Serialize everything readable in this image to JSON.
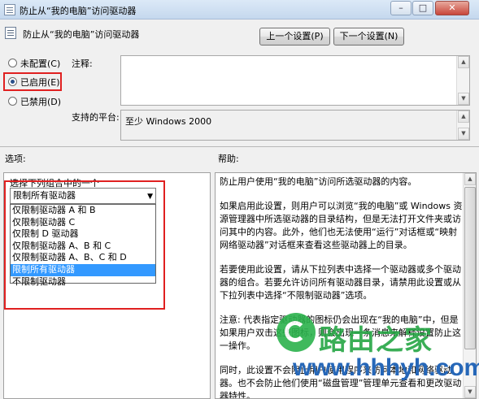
{
  "window": {
    "title": "防止从“我的电脑”访问驱动器",
    "minimize_glyph": "–",
    "maximize_glyph": "□",
    "close_glyph": "✕"
  },
  "header": {
    "policy_title": "防止从“我的电脑”访问驱动器",
    "prev_button": "上一个设置(P)",
    "next_button": "下一个设置(N)"
  },
  "state": {
    "options": [
      {
        "label": "未配置(C)",
        "checked": false
      },
      {
        "label": "已启用(E)",
        "checked": true
      },
      {
        "label": "已禁用(D)",
        "checked": false
      }
    ]
  },
  "comment": {
    "label": "注释:",
    "value": ""
  },
  "supported": {
    "label": "支持的平台:",
    "value": "至少 Windows 2000"
  },
  "options_section": {
    "label": "选项:",
    "instruction": "选择下列组合中的一个",
    "selected_value": "限制所有驱动器",
    "dropdown_items": [
      {
        "label": "仅限制驱动器 A 和 B",
        "selected": false
      },
      {
        "label": "仅限制驱动器 C",
        "selected": false
      },
      {
        "label": "仅限制 D 驱动器",
        "selected": false
      },
      {
        "label": "仅限制驱动器 A、B 和 C",
        "selected": false
      },
      {
        "label": "仅限制驱动器 A、B、C 和 D",
        "selected": false
      },
      {
        "label": "限制所有驱动器",
        "selected": true
      },
      {
        "label": "不限制驱动器",
        "selected": false
      }
    ]
  },
  "help_section": {
    "label": "帮助:",
    "paragraphs": [
      "防止用户使用“我的电脑”访问所选驱动器的内容。",
      "如果启用此设置，则用户可以浏览“我的电脑”或 Windows 资源管理器中所选驱动器的目录结构，但是无法打开文件夹或访问其中的内容。此外，他们也无法使用“运行”对话框或“映射网络驱动器”对话框来查看这些驱动器上的目录。",
      "若要使用此设置，请从下拉列表中选择一个驱动器或多个驱动器的组合。若要允许访问所有驱动器目录，请禁用此设置或从下拉列表中选择“不限制驱动器”选项。",
      "注意: 代表指定驱动器的图标仍会出现在“我的电脑”中，但是如果用户双击这些图标，则会出现一条消息来解释设置防止这一操作。",
      "同时，此设置不会阻止用户使用程序来访问本地和网络驱动器。也不会防止他们使用“磁盘管理”管理单元查看和更改驱动器特性。"
    ]
  },
  "watermark": {
    "brand": "路由之家",
    "url": "www.hhhyh.com"
  }
}
